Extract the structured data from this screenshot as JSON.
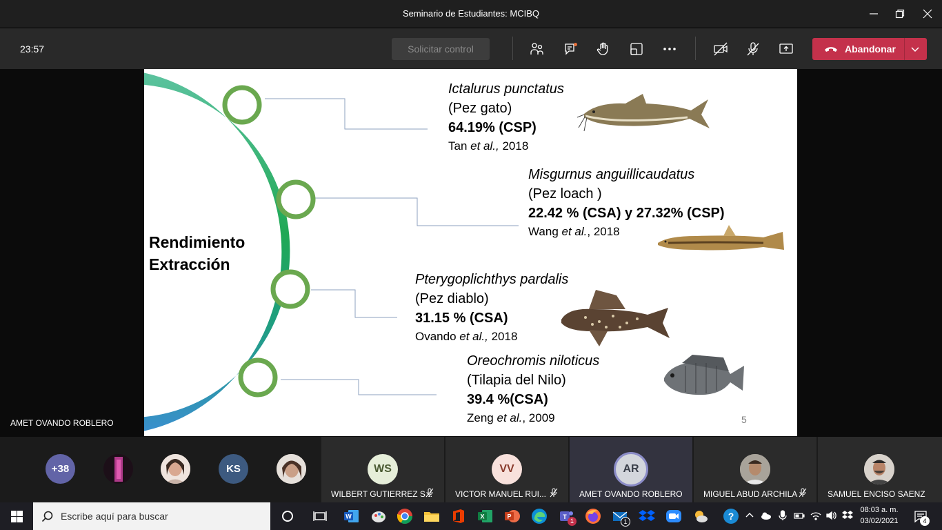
{
  "window": {
    "title": "Seminario de Estudiantes: MCIBQ"
  },
  "toolbar": {
    "timer": "23:57",
    "request_control": "Solicitar control",
    "leave_label": "Abandonar"
  },
  "slide": {
    "heading_line1": "Rendimiento",
    "heading_line2": "Extracción",
    "page_number": "5",
    "entries": [
      {
        "species": "Ictalurus punctatus",
        "common": "(Pez gato)",
        "value": "64.19% (CSP)",
        "ref_author": "Tan ",
        "ref_etal": "et al.,",
        "ref_year": " 2018"
      },
      {
        "species": "Misgurnus anguillicaudatus",
        "common": "(Pez loach )",
        "value": "22.42 % (CSA) y 27.32%  (CSP)",
        "ref_author": "Wang ",
        "ref_etal": "et al.",
        "ref_year": ", 2018"
      },
      {
        "species": "Pterygoplichthys pardalis",
        "common": "(Pez diablo)",
        "value": "31.15 % (CSA)",
        "ref_author": "Ovando ",
        "ref_etal": "et al.,",
        "ref_year": " 2018"
      },
      {
        "species": "Oreochromis niloticus",
        "common": "(Tilapia del Nilo)",
        "value": "39.4 %(CSA)",
        "ref_author": "Zeng ",
        "ref_etal": "et al.",
        "ref_year": ", 2009"
      }
    ]
  },
  "presenter": {
    "name": "AMET OVANDO ROBLERO"
  },
  "participants": {
    "overflow_count": "+38",
    "ks_initials": "KS",
    "tiles": [
      {
        "initials": "WS",
        "name": "WILBERT GUTIERREZ S...",
        "muted": true
      },
      {
        "initials": "VV",
        "name": "VICTOR MANUEL RUI...",
        "muted": true
      },
      {
        "initials": "AR",
        "name": "AMET OVANDO ROBLERO",
        "muted": false
      },
      {
        "initials": "",
        "name": "MIGUEL ABUD ARCHILA",
        "muted": true
      },
      {
        "initials": "",
        "name": "SAMUEL ENCISO SAENZ",
        "muted": false
      }
    ]
  },
  "taskbar": {
    "search_placeholder": "Escribe aquí para buscar",
    "time": "08:03 a. m.",
    "date": "03/02/2021",
    "mail_badge": "1",
    "teams_badge": "1",
    "notifications_count": "4"
  },
  "colors": {
    "leave_red": "#c4314b",
    "arc_top": "#5dc3a0",
    "arc_mid": "#1fa855",
    "arc_bottom": "#3a8fcf",
    "node_green": "#6aa84f"
  }
}
